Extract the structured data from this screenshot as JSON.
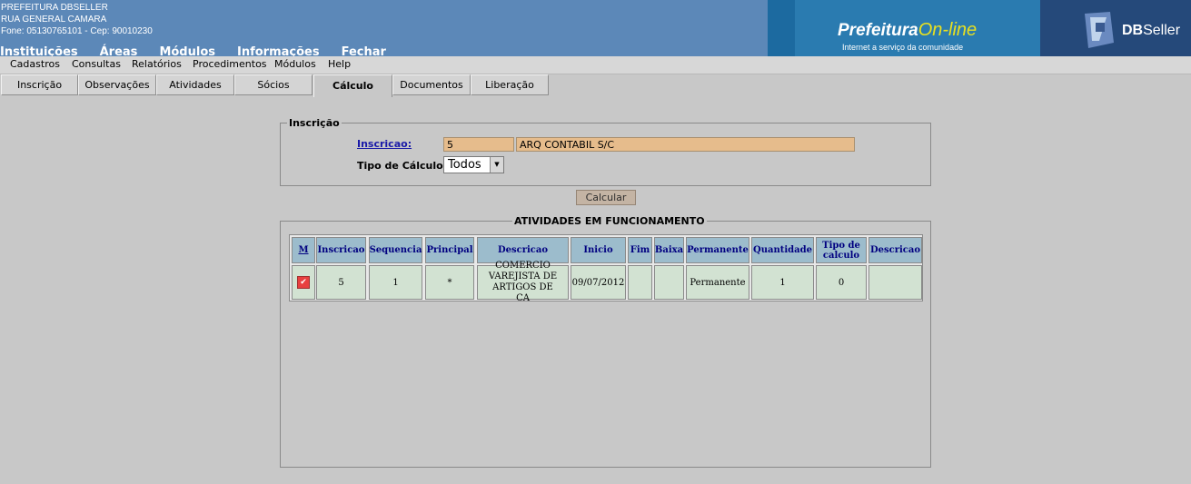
{
  "header": {
    "org_name": "PREFEITURA DBSELLER",
    "address": "RUA GENERAL CAMARA",
    "phone_line": "Fone: 05130765101  -  Cep: 90010230",
    "top_menu": [
      "Instituições",
      "Áreas",
      "Módulos",
      "Informações",
      "Fechar"
    ]
  },
  "banner": {
    "brand_main": "Prefeitura",
    "brand_accent": "On-line",
    "tagline": "Internet a serviço da comunidade",
    "vendor_bold": "DB",
    "vendor_rest": "Seller"
  },
  "menubar": [
    "Cadastros",
    "Consultas",
    "Relatórios",
    "Procedimentos",
    "Módulos",
    "Help"
  ],
  "tabs": [
    "Inscrição",
    "Observações",
    "Atividades",
    "Sócios",
    "Cálculo",
    "Documentos",
    "Liberação"
  ],
  "active_tab": "Cálculo",
  "form": {
    "legend": "Inscrição",
    "inscricao_label": "Inscricao:",
    "inscricao_value": "5",
    "nome_value": "ARQ CONTABIL S/C",
    "tipo_label": "Tipo de Cálculo:",
    "tipo_value": "Todos",
    "calcular_label": "Calcular"
  },
  "atividades": {
    "legend": "ATIVIDADES EM FUNCIONAMENTO",
    "headers": [
      "M",
      "Inscricao",
      "Sequencia",
      "Principal",
      "Descricao",
      "Inicio",
      "Fim",
      "Baixa",
      "Permanente",
      "Quantidade",
      "Tipo de calculo",
      "Descricao"
    ],
    "rows": [
      {
        "checked": true,
        "inscricao": "5",
        "sequencia": "1",
        "principal": "*",
        "descricao": "COMERCIO VAREJISTA DE ARTIGOS DE CA",
        "inicio": "09/07/2012",
        "fim": "",
        "baixa": "",
        "permanente": "Permanente",
        "quantidade": "1",
        "tipo_calculo": "0",
        "descricao2": ""
      }
    ]
  },
  "colors": {
    "header_bg": "#5c88b8",
    "banner_bg": "#2a7bb0",
    "page_bg": "#c8c8c8",
    "input_bg": "#e6bc8c",
    "table_header_bg": "#9cbccc",
    "table_row_bg": "#d2e2d2",
    "link": "#1a1aa8"
  }
}
